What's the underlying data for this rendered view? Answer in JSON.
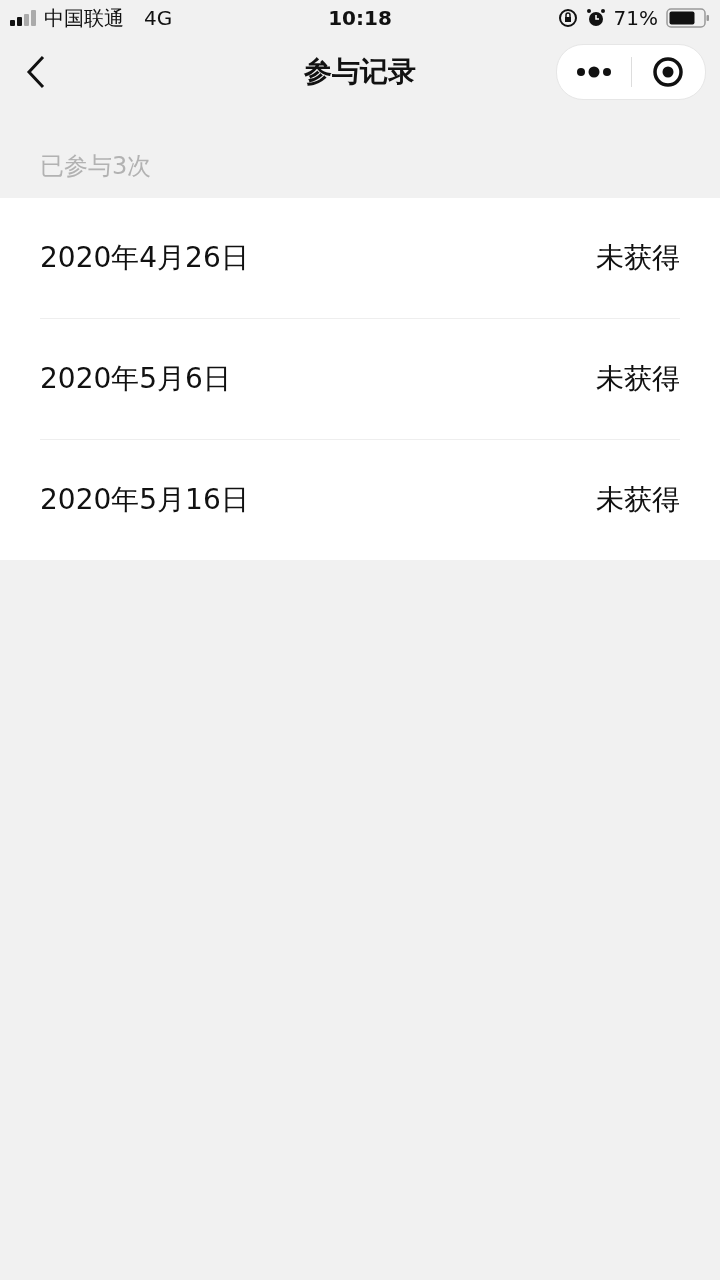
{
  "status_bar": {
    "carrier": "中国联通",
    "network": "4G",
    "time": "10:18",
    "battery_percent": "71%"
  },
  "nav_bar": {
    "title": "参与记录"
  },
  "summary": "已参与3次",
  "records": [
    {
      "date": "2020年4月26日",
      "result": "未获得"
    },
    {
      "date": "2020年5月6日",
      "result": "未获得"
    },
    {
      "date": "2020年5月16日",
      "result": "未获得"
    }
  ]
}
